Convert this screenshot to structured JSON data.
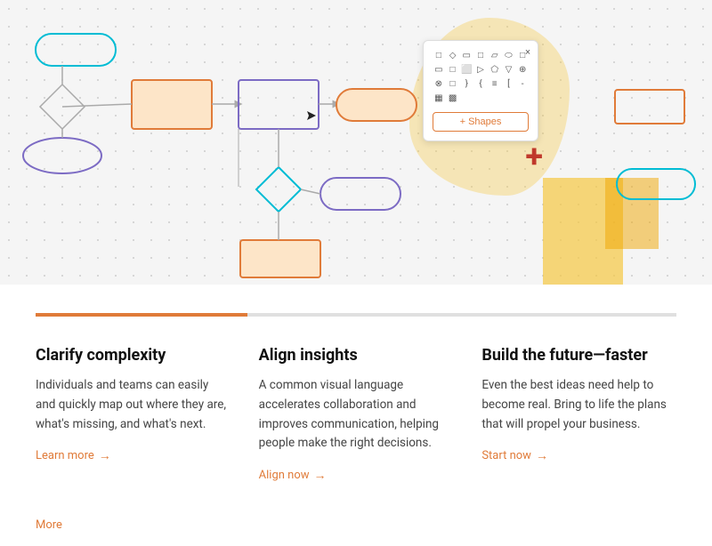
{
  "diagram": {
    "shapes_panel": {
      "close_label": "×",
      "add_button_label": "+ Shapes",
      "shape_icons": [
        "□",
        "◇",
        "□",
        "□",
        "□",
        "□",
        "□",
        "□",
        "□",
        "□",
        "□",
        "□",
        "□",
        "□",
        "□",
        "□",
        "□",
        "▽",
        "⊕",
        "⊗",
        "□",
        "□",
        "□",
        "□",
        "≡",
        "={",
        "[-",
        "▦",
        "▩"
      ]
    }
  },
  "progress": {
    "filled_percent": 33
  },
  "features": [
    {
      "title": "Clarify complexity",
      "description": "Individuals and teams can easily and quickly map out where they are, what's missing, and what's next.",
      "link_text": "Learn more",
      "link_arrow": "→"
    },
    {
      "title": "Align insights",
      "description": "A common visual language accelerates collaboration and improves communication, helping people make the right decisions.",
      "link_text": "Align now",
      "link_arrow": "→"
    },
    {
      "title": "Build the future—faster",
      "description": "Even the best ideas need help to become real. Bring to life the plans that will propel your business.",
      "link_text": "Start now",
      "link_arrow": "→"
    }
  ],
  "footer": {
    "more_label": "More"
  }
}
